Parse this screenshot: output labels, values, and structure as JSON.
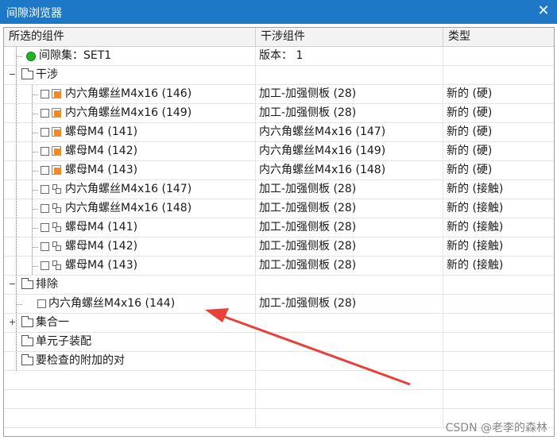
{
  "window": {
    "title": "间隙浏览器"
  },
  "columns": [
    "所选的组件",
    "干涉组件",
    "类型"
  ],
  "rows": [
    {
      "depth": 1,
      "icon": "green-circle-icon",
      "label": "间隙集：SET1",
      "col2": "版本： 1",
      "col3": ""
    },
    {
      "depth": 0,
      "expander": "−",
      "icon": "folder-icon",
      "label": "干涉",
      "col2": "",
      "col3": ""
    },
    {
      "depth": 2,
      "check": true,
      "icon": "hard-interference-icon",
      "label": "内六角螺丝M4x16 (146)",
      "col2": "加工-加强侧板 (28)",
      "col3": "新的 (硬)"
    },
    {
      "depth": 2,
      "check": true,
      "icon": "hard-interference-icon",
      "label": "内六角螺丝M4x16 (149)",
      "col2": "加工-加强侧板 (28)",
      "col3": "新的 (硬)"
    },
    {
      "depth": 2,
      "check": true,
      "icon": "hard-interference-icon",
      "label": "螺母M4 (141)",
      "col2": "内六角螺丝M4x16 (147)",
      "col3": "新的 (硬)"
    },
    {
      "depth": 2,
      "check": true,
      "icon": "hard-interference-icon",
      "label": "螺母M4 (142)",
      "col2": "内六角螺丝M4x16 (149)",
      "col3": "新的 (硬)"
    },
    {
      "depth": 2,
      "check": true,
      "icon": "hard-interference-icon",
      "label": "螺母M4 (143)",
      "col2": "内六角螺丝M4x16 (148)",
      "col3": "新的 (硬)"
    },
    {
      "depth": 2,
      "check": true,
      "icon": "touch-interference-icon",
      "label": "内六角螺丝M4x16 (147)",
      "col2": "加工-加强侧板 (28)",
      "col3": "新的 (接触)"
    },
    {
      "depth": 2,
      "check": true,
      "icon": "touch-interference-icon",
      "label": "内六角螺丝M4x16 (148)",
      "col2": "加工-加强侧板 (28)",
      "col3": "新的 (接触)"
    },
    {
      "depth": 2,
      "check": true,
      "icon": "touch-interference-icon",
      "label": "螺母M4 (141)",
      "col2": "加工-加强侧板 (28)",
      "col3": "新的 (接触)"
    },
    {
      "depth": 2,
      "check": true,
      "icon": "touch-interference-icon",
      "label": "螺母M4 (142)",
      "col2": "加工-加强侧板 (28)",
      "col3": "新的 (接触)"
    },
    {
      "depth": 2,
      "check": true,
      "icon": "touch-interference-icon",
      "label": "螺母M4 (143)",
      "col2": "加工-加强侧板 (28)",
      "col3": "新的 (接触)"
    },
    {
      "depth": 0,
      "expander": "−",
      "icon": "folder-icon",
      "label": "排除",
      "col2": "",
      "col3": ""
    },
    {
      "depth": 1,
      "check": true,
      "icon": "",
      "label": "内六角螺丝M4x16 (144)",
      "col2": "加工-加强侧板 (28)",
      "col3": ""
    },
    {
      "depth": 0,
      "expander": "+",
      "icon": "folder-icon",
      "label": "集合一",
      "col2": "",
      "col3": ""
    },
    {
      "depth": 0,
      "icon": "folder-icon",
      "label": "单元子装配",
      "col2": "",
      "col3": ""
    },
    {
      "depth": 0,
      "icon": "folder-icon",
      "label": "要检查的附加的对",
      "col2": "",
      "col3": ""
    },
    {
      "depth": -1,
      "label": "",
      "col2": "",
      "col3": ""
    },
    {
      "depth": -1,
      "label": "",
      "col2": "",
      "col3": ""
    },
    {
      "depth": -1,
      "label": "",
      "col2": "",
      "col3": ""
    }
  ],
  "watermark": "CSDN @老李的森林",
  "colors": {
    "titlebar": "#1e78c8",
    "annotation_arrow": "#e8403a"
  }
}
